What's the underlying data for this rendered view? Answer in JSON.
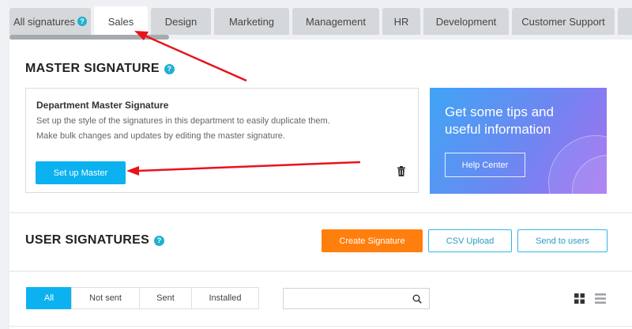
{
  "tabs": [
    {
      "label": "All signatures",
      "help": "?"
    },
    {
      "label": "Sales"
    },
    {
      "label": "Design"
    },
    {
      "label": "Marketing"
    },
    {
      "label": "Management"
    },
    {
      "label": "HR"
    },
    {
      "label": "Development"
    },
    {
      "label": "Customer Support"
    }
  ],
  "active_tab": "Sales",
  "master": {
    "section_title": "MASTER SIGNATURE",
    "help": "?",
    "card_title": "Department Master Signature",
    "line1": "Set up the style of the signatures in this department to easily duplicate them.",
    "line2": "Make bulk changes and updates by editing the master signature.",
    "setup_button": "Set up Master",
    "delete_icon": "trash-icon"
  },
  "tips": {
    "headline": "Get some tips and useful information",
    "button": "Help Center"
  },
  "users": {
    "section_title": "USER SIGNATURES",
    "help": "?",
    "create_button": "Create Signature",
    "csv_button": "CSV Upload",
    "send_button": "Send to users"
  },
  "filters": {
    "segments": [
      "All",
      "Not sent",
      "Sent",
      "Installed"
    ],
    "active": "All",
    "search_placeholder": "",
    "search_icon": "search-icon",
    "grid_view_icon": "grid-view-icon",
    "list_view_icon": "list-view-icon"
  },
  "colors": {
    "accent_blue": "#0bb2ef",
    "orange": "#ff7f0e",
    "annotation_red": "#e8131b",
    "help_badge": "#1fb0d0"
  }
}
